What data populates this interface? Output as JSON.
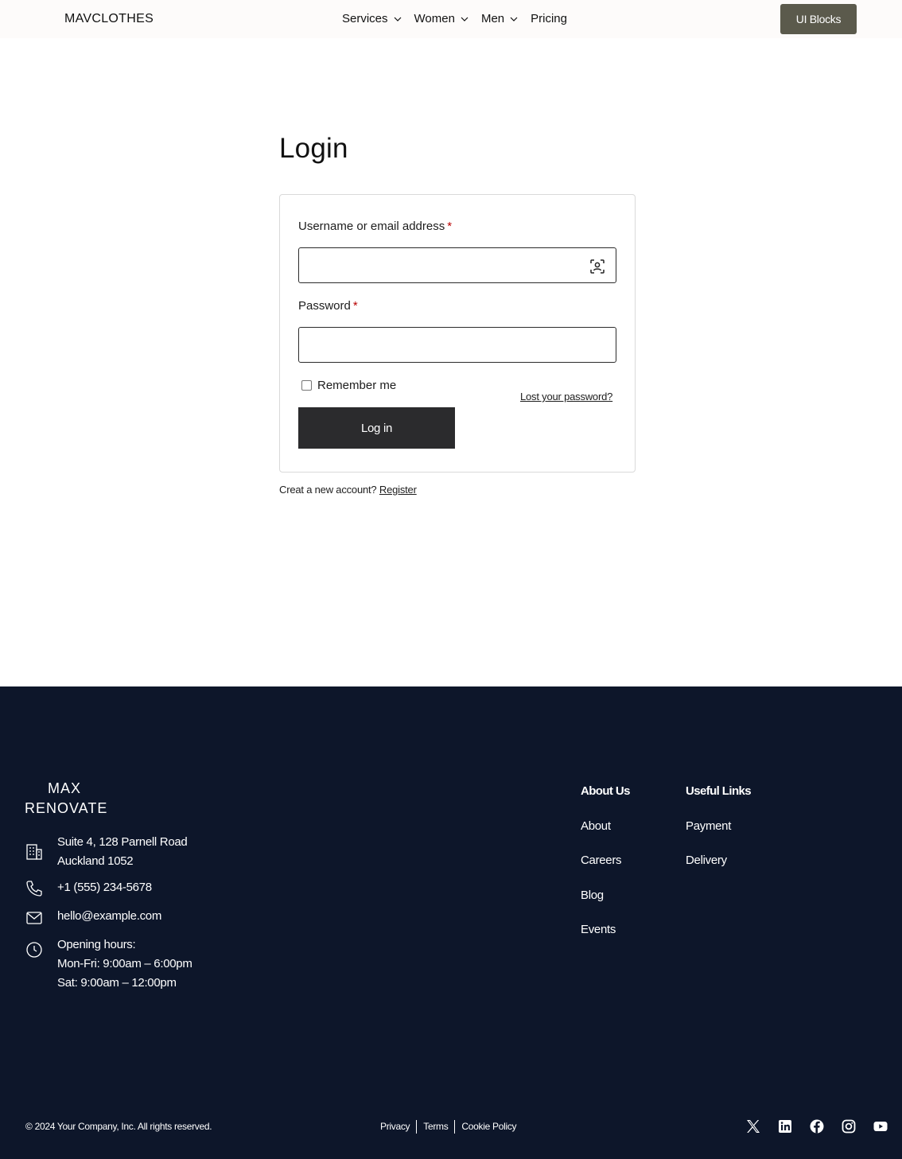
{
  "header": {
    "brand": "MAVCLOTHES",
    "nav": [
      {
        "label": "Services",
        "has_dropdown": true
      },
      {
        "label": "Women",
        "has_dropdown": true
      },
      {
        "label": "Men",
        "has_dropdown": true
      },
      {
        "label": "Pricing",
        "has_dropdown": false
      }
    ],
    "cta_label": "UI Blocks"
  },
  "login": {
    "title": "Login",
    "username_label": "Username or email address",
    "password_label": "Password",
    "required_mark": "*",
    "username_value": "",
    "password_value": "",
    "remember_label": "Remember me",
    "remember_checked": false,
    "lost_password": "Lost your password?",
    "submit_label": "Log in",
    "register_prompt": "Creat a new account?",
    "register_link": "Register"
  },
  "footer": {
    "logo_line1": "MAX",
    "logo_line2": "RENOVATE",
    "address_line1": "Suite 4, 128 Parnell Road",
    "address_line2": "Auckland 1052",
    "phone": "+1 (555) 234-5678",
    "email": "hello@example.com",
    "hours_title": "Opening hours:",
    "hours_weekday": "Mon-Fri: 9:00am – 6:00pm",
    "hours_sat": "Sat: 9:00am – 12:00pm",
    "about_heading": "About Us",
    "about_links": [
      "About",
      "Careers",
      "Blog",
      "Events"
    ],
    "useful_heading": "Useful Links",
    "useful_links": [
      "Payment",
      "Delivery"
    ],
    "copyright": "© 2024 Your Company, Inc. All rights reserved.",
    "legal_links": [
      "Privacy",
      "Terms",
      "Cookie Policy"
    ],
    "social": [
      "x-icon",
      "linkedin-icon",
      "facebook-icon",
      "instagram-icon",
      "youtube-icon"
    ]
  },
  "colors": {
    "header_bg": "#fdfbfa",
    "cta_bg": "#5b5a4c",
    "button_bg": "#2b2b2d",
    "footer_bg": "#0d162a",
    "required": "#b80000"
  }
}
